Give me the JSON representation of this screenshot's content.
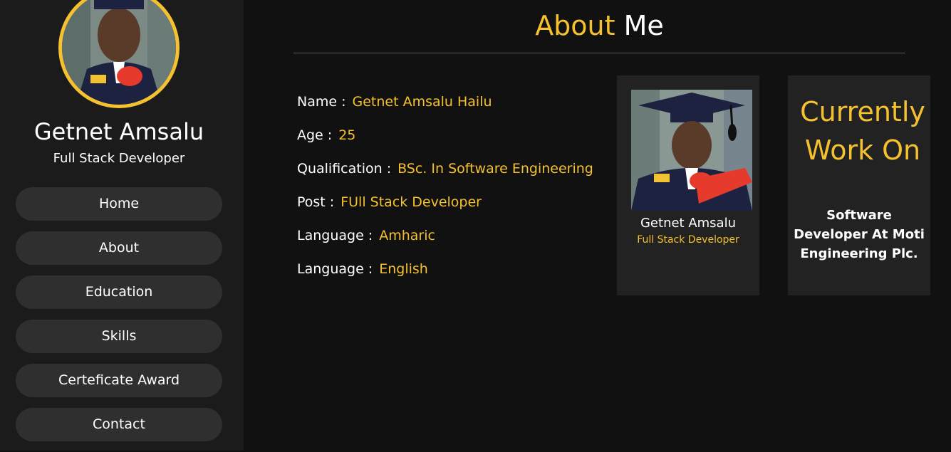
{
  "profile": {
    "name": "Getnet Amsalu",
    "role": "Full Stack Developer"
  },
  "nav": [
    {
      "label": "Home"
    },
    {
      "label": "About"
    },
    {
      "label": "Education"
    },
    {
      "label": "Skills"
    },
    {
      "label": "Certeficate Award"
    },
    {
      "label": "Contact"
    }
  ],
  "about": {
    "title_accent": "About",
    "title_rest": " Me",
    "fields": [
      {
        "label": "Name :",
        "value": "Getnet Amsalu Hailu"
      },
      {
        "label": "Age :",
        "value": "25"
      },
      {
        "label": "Qualification :",
        "value": "BSc. In Software Engineering"
      },
      {
        "label": "Post :",
        "value": "FUll Stack Developer"
      },
      {
        "label": "Language :",
        "value": "Amharic"
      },
      {
        "label": "Language :",
        "value": "English"
      }
    ]
  },
  "card": {
    "name": "Getnet Amsalu",
    "role": "Full Stack Developer"
  },
  "work": {
    "title": "Currently Work On",
    "description": "Software Developer At Moti Engineering Plc."
  },
  "colors": {
    "accent": "#f5c12e",
    "background": "#111111",
    "sidebar": "#1b1b1b",
    "button": "#2f2f2f",
    "card": "#222222"
  }
}
